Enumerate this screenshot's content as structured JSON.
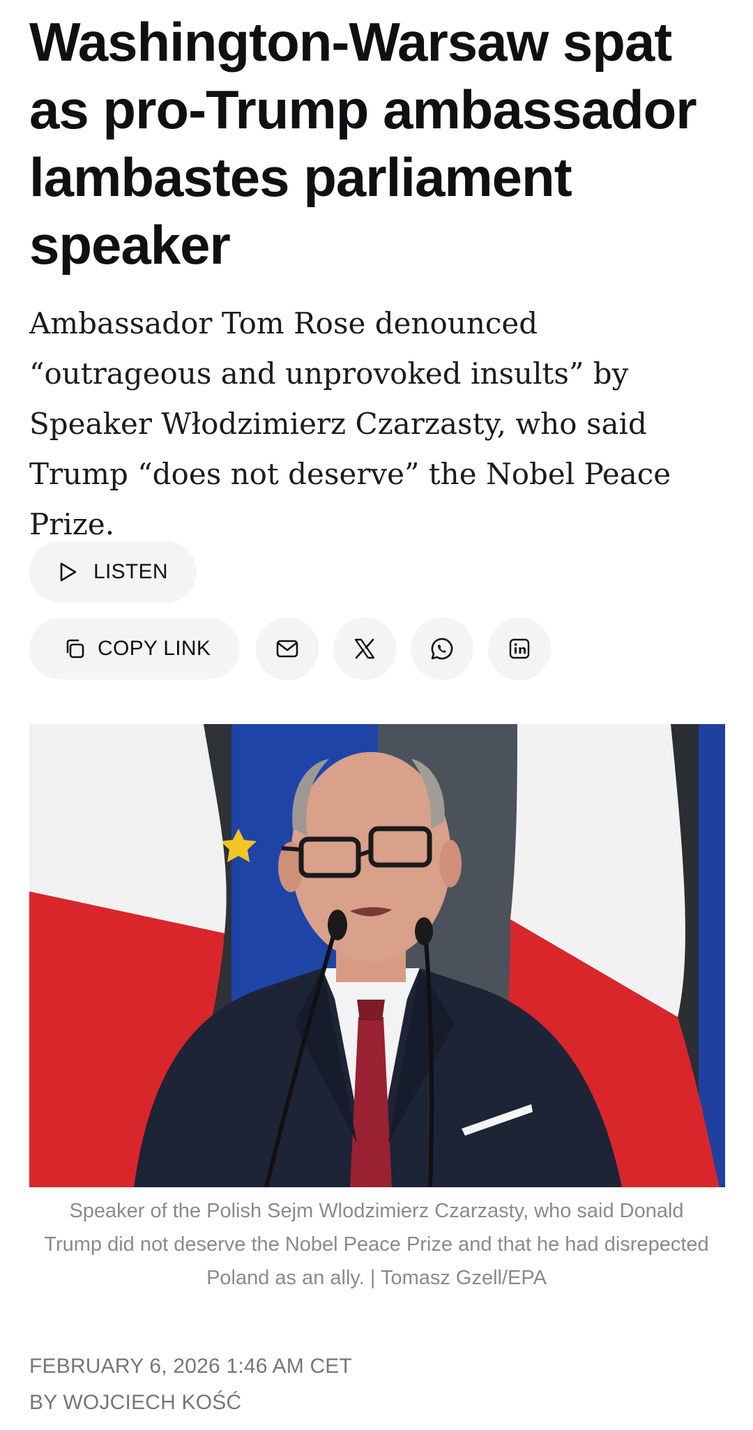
{
  "article": {
    "headline": "Washington-Warsaw spat as pro-Trump ambassador lambastes parliament speaker",
    "dek": "Ambassador Tom Rose denounced “outrageous and unprovoked insults” by Speaker Włodzimierz Czarzasty, who said Trump “does not deserve” the Nobel Peace Prize.",
    "caption": "Speaker of the Polish Sejm Wlodzimierz Czarzasty, who said Donald Trump did not deserve the Nobel Peace Prize and that he had disrepected Poland as an ally. | Tomasz Gzell/EPA",
    "dateline": "FEBRUARY 6, 2026 1:46 AM CET",
    "byline": "BY WOJCIECH KOŚĆ"
  },
  "actions": {
    "listen_label": "LISTEN",
    "listen_icon": "play-icon",
    "copy_link_label": "COPY LINK",
    "copy_link_icon": "copy-icon",
    "share_icons": [
      "mail-icon",
      "x-icon",
      "whatsapp-icon",
      "linkedin-icon"
    ]
  },
  "photo": {
    "subject": "speaker-at-podium-photo"
  },
  "colors": {
    "headline": "#0f1012",
    "body": "#1b1b1b",
    "muted": "#767676",
    "caption": "#8a8a8a",
    "button_bg": "#f4f4f4",
    "flag_red": "#d9262b",
    "eu_blue": "#1f44a8"
  }
}
